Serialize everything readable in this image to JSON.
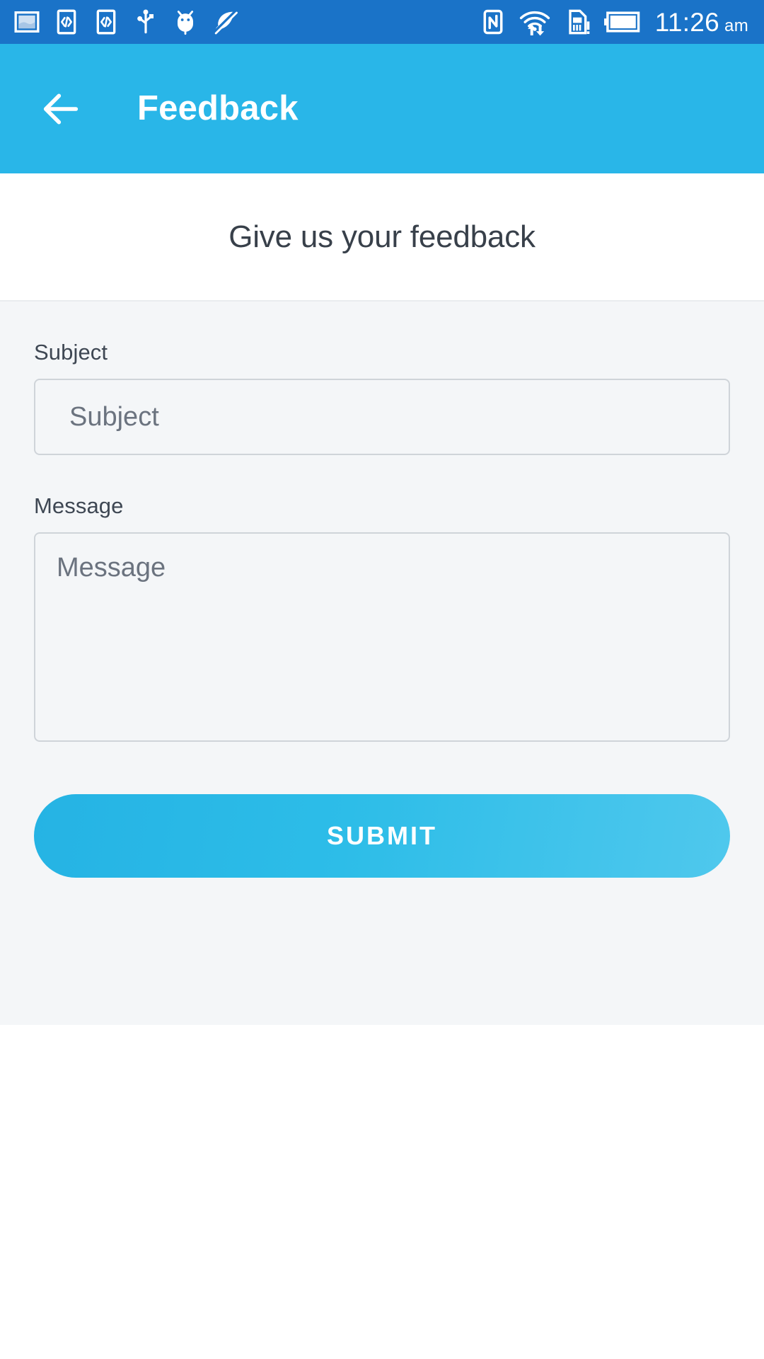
{
  "status_bar": {
    "background_color": "#1a73c8",
    "left_icons": [
      {
        "name": "screenshot-icon",
        "label": "screenshot"
      },
      {
        "name": "developer-mode-icon",
        "label": "developer options"
      },
      {
        "name": "developer-mode-secondary-icon",
        "label": "developer options"
      },
      {
        "name": "usb-icon",
        "label": "usb connected"
      },
      {
        "name": "android-debug-icon",
        "label": "android debugging"
      },
      {
        "name": "battery-saver-off-icon",
        "label": "battery saver off"
      }
    ],
    "right_icons": [
      {
        "name": "nfc-icon",
        "label": "nfc"
      },
      {
        "name": "wifi-data-icon",
        "label": "wifi with data transfer"
      },
      {
        "name": "sim-card-alert-icon",
        "label": "no sim card"
      },
      {
        "name": "battery-full-icon",
        "label": "battery"
      }
    ],
    "time": "11:26",
    "meridiem": "am"
  },
  "app_bar": {
    "background_color": "#29b6e8",
    "back_icon": "arrow-left-icon",
    "title": "Feedback"
  },
  "content": {
    "heading": "Give us your feedback",
    "section_background": "#f4f6f8"
  },
  "form": {
    "subject": {
      "label": "Subject",
      "placeholder": "Subject",
      "value": ""
    },
    "message": {
      "label": "Message",
      "placeholder": "Message",
      "value": ""
    },
    "submit": {
      "label": "SUBMIT",
      "accent_color": "#2dbde8"
    }
  }
}
